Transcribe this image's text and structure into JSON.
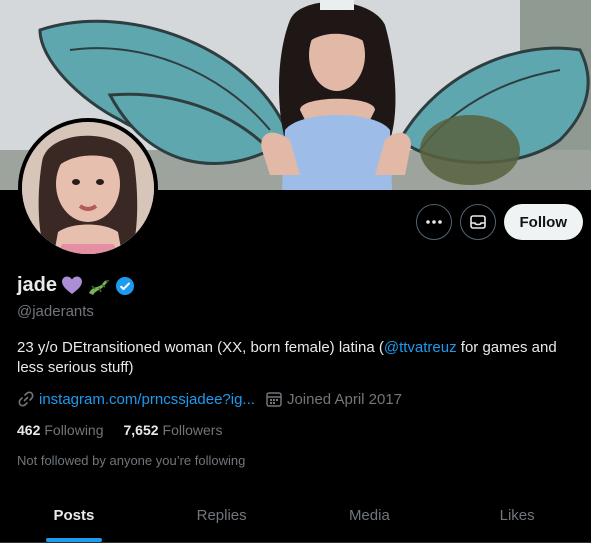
{
  "profile": {
    "name": "jade",
    "handle": "@jaderants",
    "bio_prefix": "23 y/o DEtransitioned woman (XX, born female) latina (",
    "bio_mention": "@ttvatreuz",
    "bio_suffix": " for games and less serious stuff)",
    "link_text": "instagram.com/prncssjadee?ig...",
    "joined": "Joined April 2017",
    "following_count": "462",
    "following_label": "Following",
    "followers_count": "7,652",
    "followers_label": "Followers",
    "not_followed": "Not followed by anyone you’re following",
    "verified_color": "#1d9bf0"
  },
  "actions": {
    "more_icon": "more-icon",
    "message_icon": "mail-icon",
    "follow_label": "Follow"
  },
  "tabs": [
    {
      "label": "Posts",
      "active": true
    },
    {
      "label": "Replies",
      "active": false
    },
    {
      "label": "Media",
      "active": false
    },
    {
      "label": "Likes",
      "active": false
    }
  ]
}
